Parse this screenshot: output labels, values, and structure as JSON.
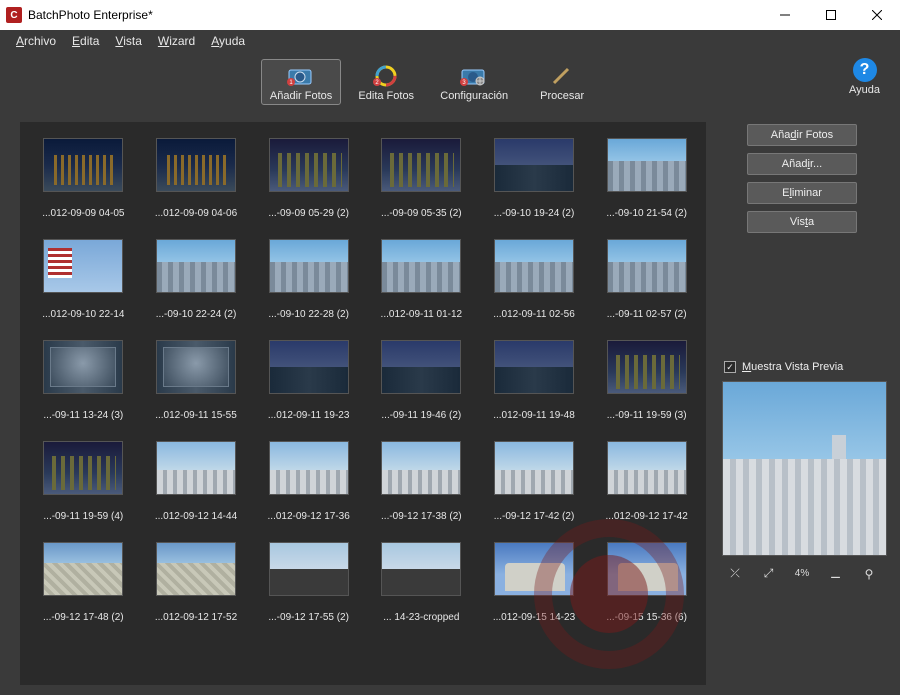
{
  "window": {
    "title": "BatchPhoto Enterprise*"
  },
  "menu": {
    "archivo": "Archivo",
    "archivo_u": "A",
    "edita": "Edita",
    "edita_u": "E",
    "vista": "Vista",
    "vista_u": "V",
    "wizard": "Wizard",
    "wizard_u": "W",
    "ayuda": "Ayuda",
    "ayuda_u": "A"
  },
  "toolbar": {
    "add": "Añadir Fotos",
    "edit": "Edita Fotos",
    "config": "Configuración",
    "process": "Procesar",
    "help": "Ayuda"
  },
  "actions": {
    "add_fotos_pre": "Aña",
    "add_fotos_u": "d",
    "add_fotos_post": "ir Fotos",
    "add_pre": "Añad",
    "add_u": "i",
    "add_post": "r...",
    "eliminar_pre": "E",
    "eliminar_u": "l",
    "eliminar_post": "iminar",
    "vista_pre": "Vis",
    "vista_u": "t",
    "vista_post": "a"
  },
  "preview": {
    "label_pre": "",
    "label_u": "M",
    "label_post": "uestra Vista Previa",
    "checked": "✓",
    "zoom_pct": "4%"
  },
  "thumbs": [
    {
      "label": "...012-09-09 04-05",
      "style": "sk-night"
    },
    {
      "label": "...012-09-09 04-06",
      "style": "sk-night"
    },
    {
      "label": "...-09-09 05-29 (2)",
      "style": "sk-night2"
    },
    {
      "label": "...-09-09 05-35 (2)",
      "style": "sk-night2"
    },
    {
      "label": "...-09-10 19-24 (2)",
      "style": "sk-dusk"
    },
    {
      "label": "...-09-10 21-54 (2)",
      "style": "sk-day"
    },
    {
      "label": "...012-09-10 22-14",
      "style": "sk-flag"
    },
    {
      "label": "...-09-10 22-24 (2)",
      "style": "sk-day"
    },
    {
      "label": "...-09-10 22-28 (2)",
      "style": "sk-day"
    },
    {
      "label": "...012-09-11 01-12",
      "style": "sk-day"
    },
    {
      "label": "...012-09-11 02-56",
      "style": "sk-day"
    },
    {
      "label": "...-09-11 02-57 (2)",
      "style": "sk-day"
    },
    {
      "label": "...-09-11 13-24 (3)",
      "style": "sk-int"
    },
    {
      "label": "...012-09-11 15-55",
      "style": "sk-int"
    },
    {
      "label": "...012-09-11 19-23",
      "style": "sk-dusk"
    },
    {
      "label": "...-09-11 19-46 (2)",
      "style": "sk-dusk"
    },
    {
      "label": "...012-09-11 19-48",
      "style": "sk-dusk"
    },
    {
      "label": "...-09-11 19-59 (3)",
      "style": "sk-night2"
    },
    {
      "label": "...-09-11 19-59 (4)",
      "style": "sk-night2"
    },
    {
      "label": "...012-09-12 14-44",
      "style": "sk-city"
    },
    {
      "label": "...012-09-12 17-36",
      "style": "sk-city"
    },
    {
      "label": "...-09-12 17-38 (2)",
      "style": "sk-city"
    },
    {
      "label": "...-09-12 17-42 (2)",
      "style": "sk-city"
    },
    {
      "label": "...012-09-12 17-42",
      "style": "sk-city"
    },
    {
      "label": "...-09-12 17-48 (2)",
      "style": "sk-aerial"
    },
    {
      "label": "...012-09-12 17-52",
      "style": "sk-aerial"
    },
    {
      "label": "...-09-12 17-55 (2)",
      "style": "sk-dash"
    },
    {
      "label": "... 14-23-cropped",
      "style": "sk-dash"
    },
    {
      "label": "...012-09-15 14-23",
      "style": "sk-civic"
    },
    {
      "label": "...-09-15 15-36 (6)",
      "style": "sk-civic"
    }
  ]
}
